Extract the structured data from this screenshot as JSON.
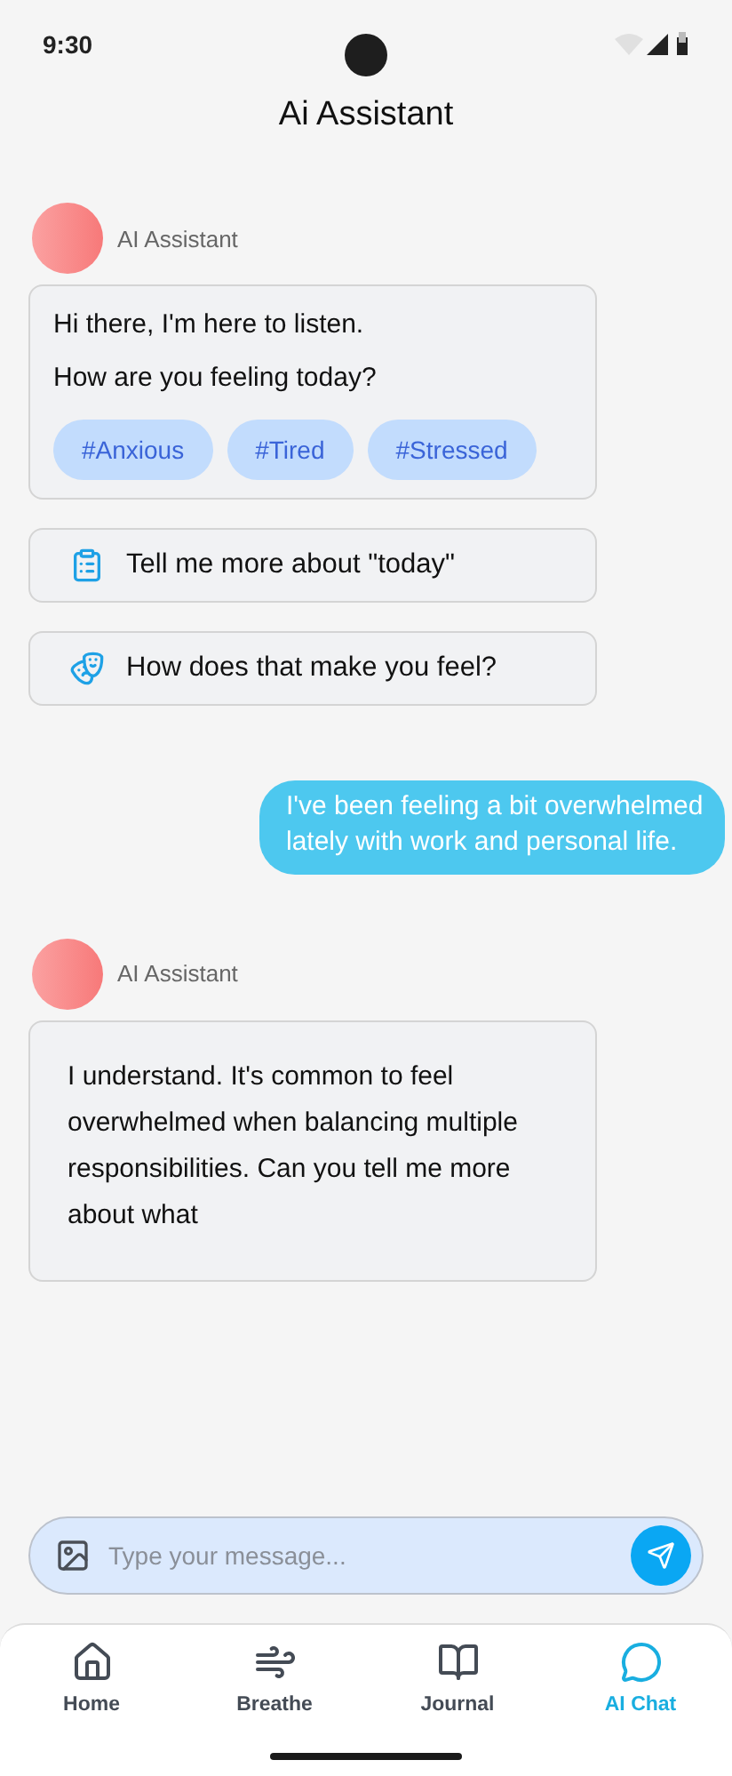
{
  "status_bar": {
    "time": "9:30"
  },
  "header": {
    "title": "Ai Assistant"
  },
  "messages": [
    {
      "kind": "assistant",
      "sender": "AI Assistant",
      "paragraphs": [
        "Hi there, I'm here to listen.",
        "How are you feeling today?"
      ],
      "tags": [
        "#Anxious",
        "#Tired",
        "#Stressed"
      ]
    },
    {
      "kind": "suggestion",
      "text": "Tell me more about \"today\""
    },
    {
      "kind": "suggestion",
      "text": "How does that make you feel?"
    },
    {
      "kind": "user",
      "text": "I've been feeling a bit overwhelmed lately with work and personal life."
    },
    {
      "kind": "assistant",
      "sender": "AI Assistant",
      "paragraphs": [
        "I understand. It's common to feel overwhelmed when balancing multiple responsibilities. Can you tell me more about what"
      ]
    }
  ],
  "composer": {
    "placeholder": "Type your message..."
  },
  "nav": [
    {
      "label": "Home",
      "selected": false
    },
    {
      "label": "Breathe",
      "selected": false
    },
    {
      "label": "Journal",
      "selected": false
    },
    {
      "label": "AI Chat",
      "selected": true
    }
  ]
}
